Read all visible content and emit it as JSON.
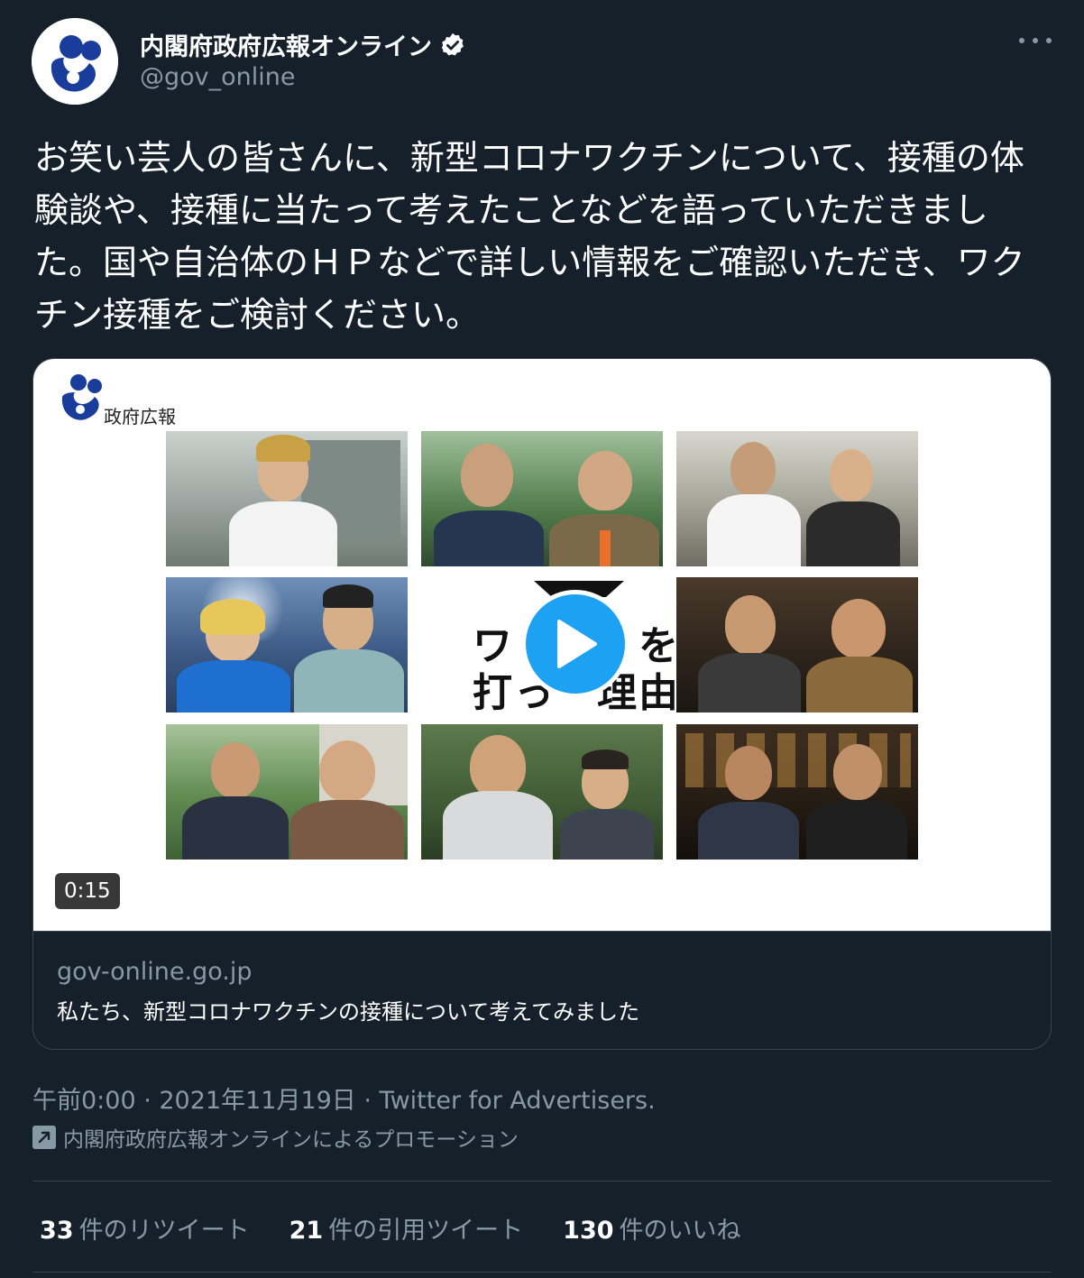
{
  "author": {
    "display_name": "内閣府政府広報オンライン",
    "handle": "@gov_online",
    "verified": true,
    "avatar_icon": "gov-logo-icon"
  },
  "tweet": {
    "text": "お笑い芸人の皆さんに、新型コロナワクチンについて、接種の体験談や、接種に当たって考えたことなどを語っていただきました。国や自治体のＨＰなどで詳しい情報をご確認いただき、ワクチン接種をご検討ください。"
  },
  "card": {
    "logo_text": "政府広報",
    "center_text_line1": "ワ　　　を",
    "center_text_line2": "打っ　理由",
    "duration": "0:15",
    "domain": "gov-online.go.jp",
    "title": "私たち、新型コロナワクチンの接種について考えてみました"
  },
  "meta": {
    "timestamp": "午前0:00 · 2021年11月19日 · Twitter for Advertisers.",
    "promotion": "内閣府政府広報オンラインによるプロモーション"
  },
  "stats": {
    "retweets_count": "33",
    "retweets_label": "件のリツイート",
    "quotes_count": "21",
    "quotes_label": "件の引用ツイート",
    "likes_count": "130",
    "likes_label": "件のいいね"
  },
  "colors": {
    "background": "#15202b",
    "secondary_text": "#8899a6",
    "border": "#38444d",
    "accent": "#1da1f2",
    "logo_blue": "#1a3d9c"
  }
}
